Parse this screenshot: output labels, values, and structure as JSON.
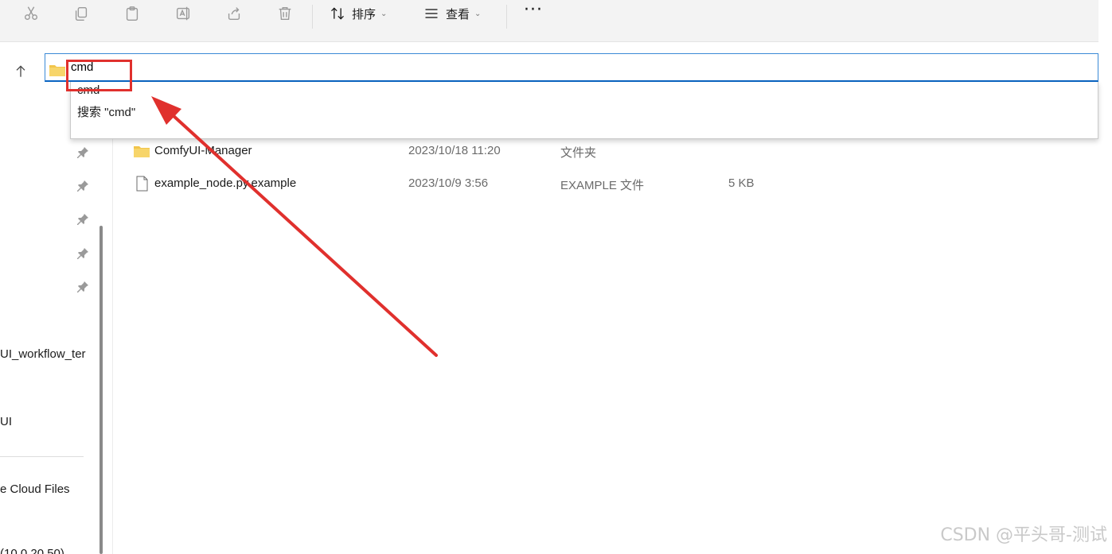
{
  "toolbar": {
    "icons": [
      "cut-icon",
      "copy-icon",
      "paste-icon",
      "rename-icon",
      "share-icon",
      "delete-icon"
    ],
    "sort_label": "排序",
    "view_label": "查看",
    "more_label": "···"
  },
  "address": {
    "value": "cmd"
  },
  "suggestions": {
    "item1": "cmd",
    "item2": "搜索 \"cmd\""
  },
  "nav": {
    "item_workflow": "UI_workflow_ter",
    "item_ui": "UI",
    "item_cloud": "e Cloud Files",
    "item_bottom": "(10.0.20.50)"
  },
  "files": [
    {
      "name": "ComfyUI-Manager",
      "date": "2023/10/18 11:20",
      "type": "文件夹",
      "size": "",
      "icon": "folder-icon"
    },
    {
      "name": "example_node.py.example",
      "date": "2023/10/9 3:56",
      "type": "EXAMPLE 文件",
      "size": "5 KB",
      "icon": "file-icon"
    }
  ],
  "annotation_color": "#e0302d",
  "accent": "#0a64c2",
  "watermark": "CSDN @平头哥-测试"
}
